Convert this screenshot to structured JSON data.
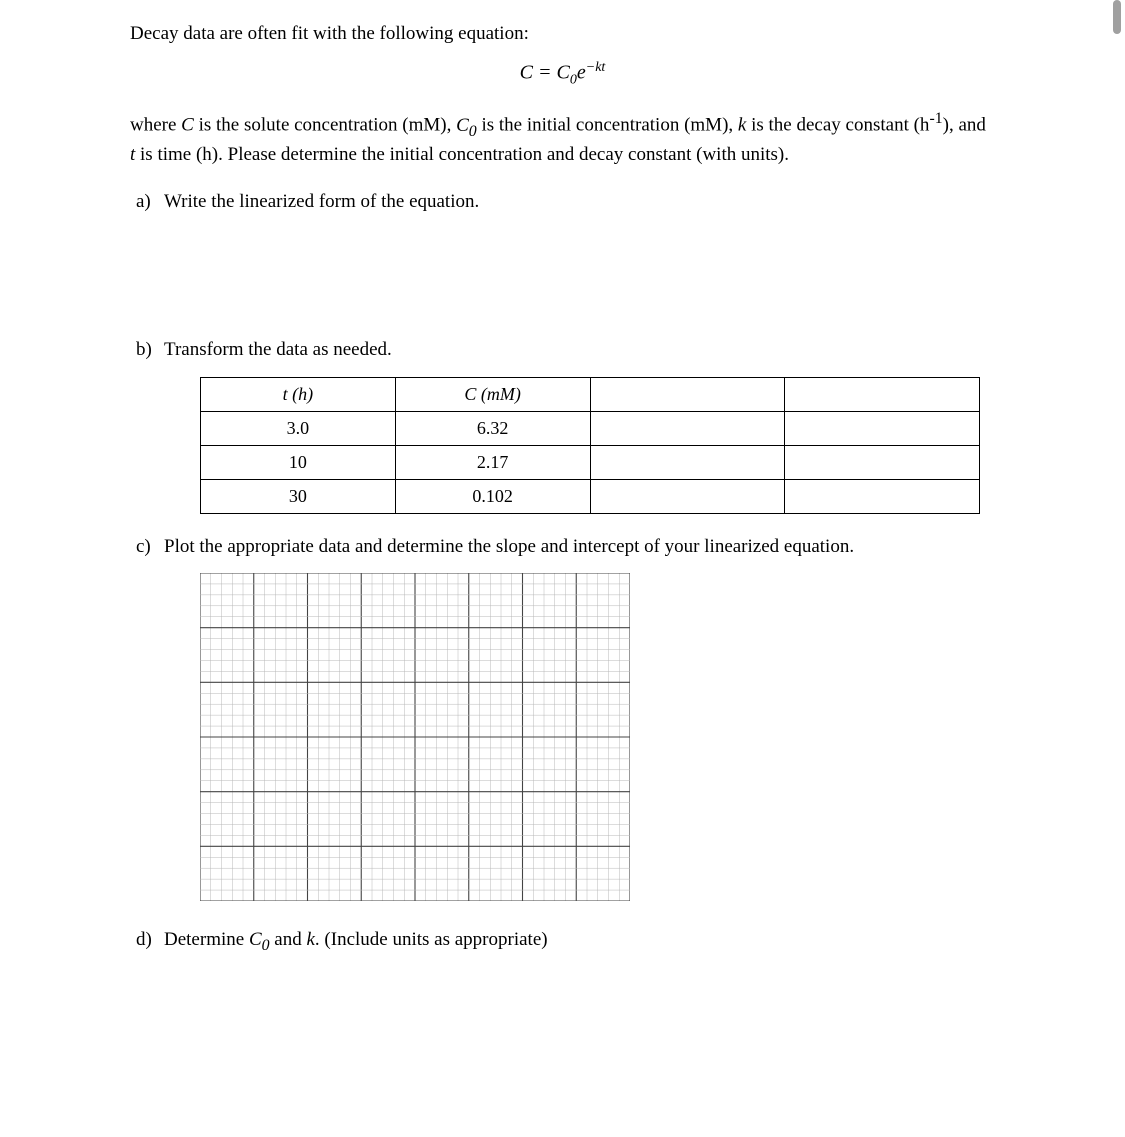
{
  "intro": "Decay data are often fit with the following equation:",
  "equation_html": "C = C<sub>0</sub>e<sup>−kt</sup>",
  "desc_html": "where <span class='italic'>C</span> is the solute concentration (mM), <span class='italic'>C<sub>0</sub></span> is the initial concentration (mM), <span class='italic'>k</span> is the decay constant (h<sup>-1</sup>), and <span class='italic'>t</span> is time (h).  Please determine the initial concentration and decay constant (with units).",
  "parts": {
    "a": {
      "label": "a)",
      "text": "Write the linearized form of the equation."
    },
    "b": {
      "label": "b)",
      "text": "Transform the data as needed."
    },
    "c": {
      "label": "c)",
      "text": "Plot the appropriate data and determine the slope and intercept of your linearized equation."
    },
    "d": {
      "label": "d)",
      "text_html": "Determine <span class='italic'>C<sub>0</sub></span> and <span class='italic'>k</span>. (Include units as appropriate)"
    }
  },
  "table": {
    "headers": {
      "t": "t (h)",
      "c": "C (mM)",
      "col3": "",
      "col4": ""
    },
    "rows": [
      {
        "t": "3.0",
        "c": "6.32",
        "col3": "",
        "col4": ""
      },
      {
        "t": "10",
        "c": "2.17",
        "col3": "",
        "col4": ""
      },
      {
        "t": "30",
        "c": "0.102",
        "col3": "",
        "col4": ""
      }
    ]
  },
  "chart_data": {
    "type": "scatter",
    "title": "",
    "xlabel": "",
    "ylabel": "",
    "grid": {
      "major_x": 8,
      "major_y": 6,
      "minor_per_major": 5
    },
    "series": []
  }
}
